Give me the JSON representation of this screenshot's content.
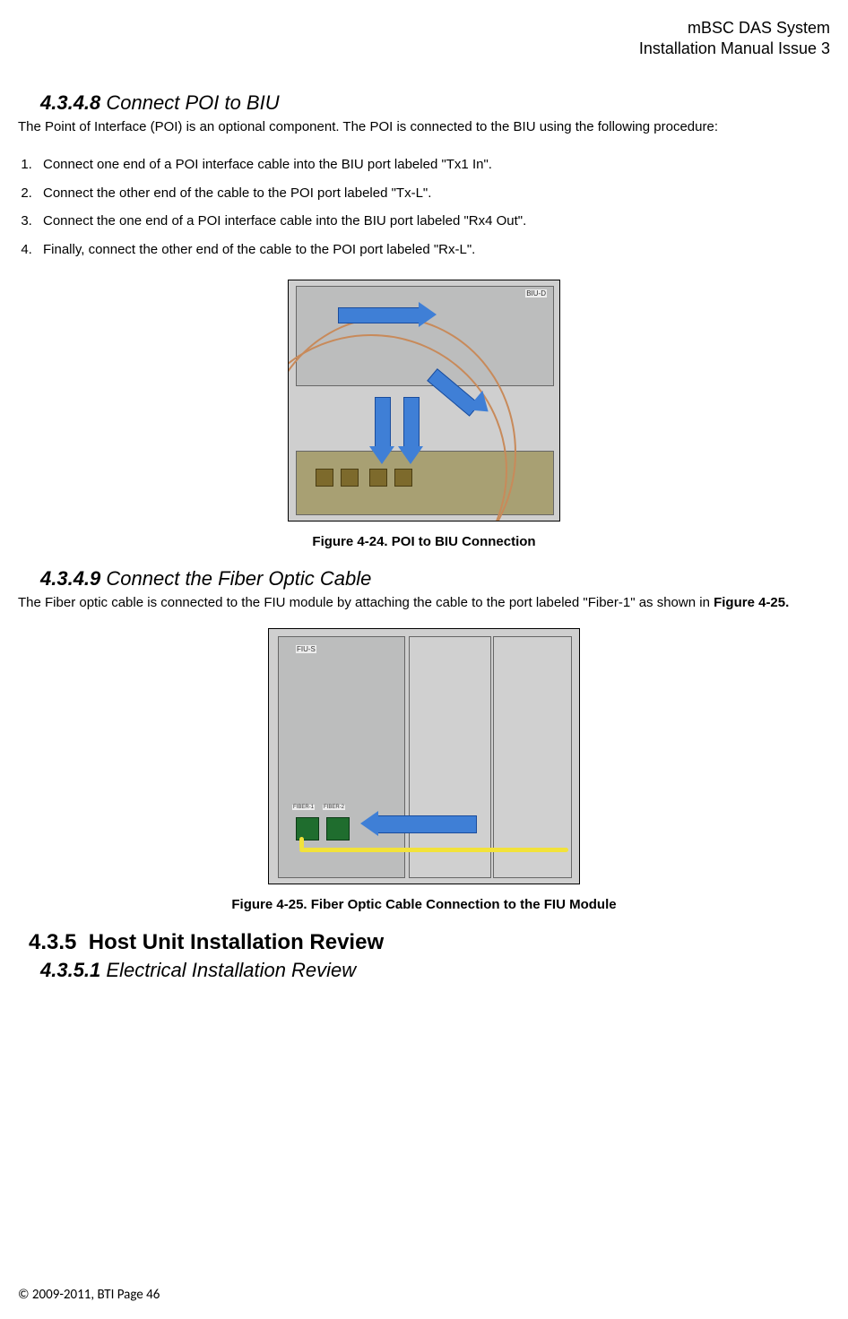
{
  "header": {
    "line1": "mBSC DAS System",
    "line2": "Installation Manual Issue 3"
  },
  "section_4348": {
    "number": "4.3.4.8",
    "title": " Connect POI to BIU",
    "intro": "The Point of Interface (POI) is an optional component. The POI is connected to the BIU using the following procedure:",
    "steps": [
      "Connect one end of a POI interface cable into the BIU port labeled \"Tx1 In\".",
      "Connect the other end of the cable to the POI port labeled \"Tx-L\".",
      "Connect the one end of a POI interface cable into the BIU port labeled \"Rx4 Out\".",
      "Finally, connect the other end of the cable to the POI port labeled \"Rx-L\"."
    ],
    "figure_caption": "Figure 4-24. POI to BIU Connection"
  },
  "section_4349": {
    "number": "4.3.4.9",
    "title": " Connect the Fiber Optic Cable",
    "intro_part1": "The Fiber optic cable is connected to the FIU module by attaching the cable to the port labeled \"Fiber-1\" as shown in ",
    "intro_bold": "Figure 4-25.",
    "figure_caption": "Figure 4-25. Fiber Optic Cable Connection to the FIU Module"
  },
  "section_435": {
    "number": "4.3.5",
    "title": "Host Unit Installation Review"
  },
  "section_4351": {
    "number": "4.3.5.1",
    "title": " Electrical Installation Review"
  },
  "footer": {
    "copyright": "© 2009-2011, BTI Page ",
    "page": "46"
  },
  "figure1_labels": {
    "biu": "BIU-D"
  },
  "figure2_labels": {
    "fiu": "FIU-S",
    "fiber1": "FIBER-1",
    "fiber2": "FIBER-2"
  }
}
